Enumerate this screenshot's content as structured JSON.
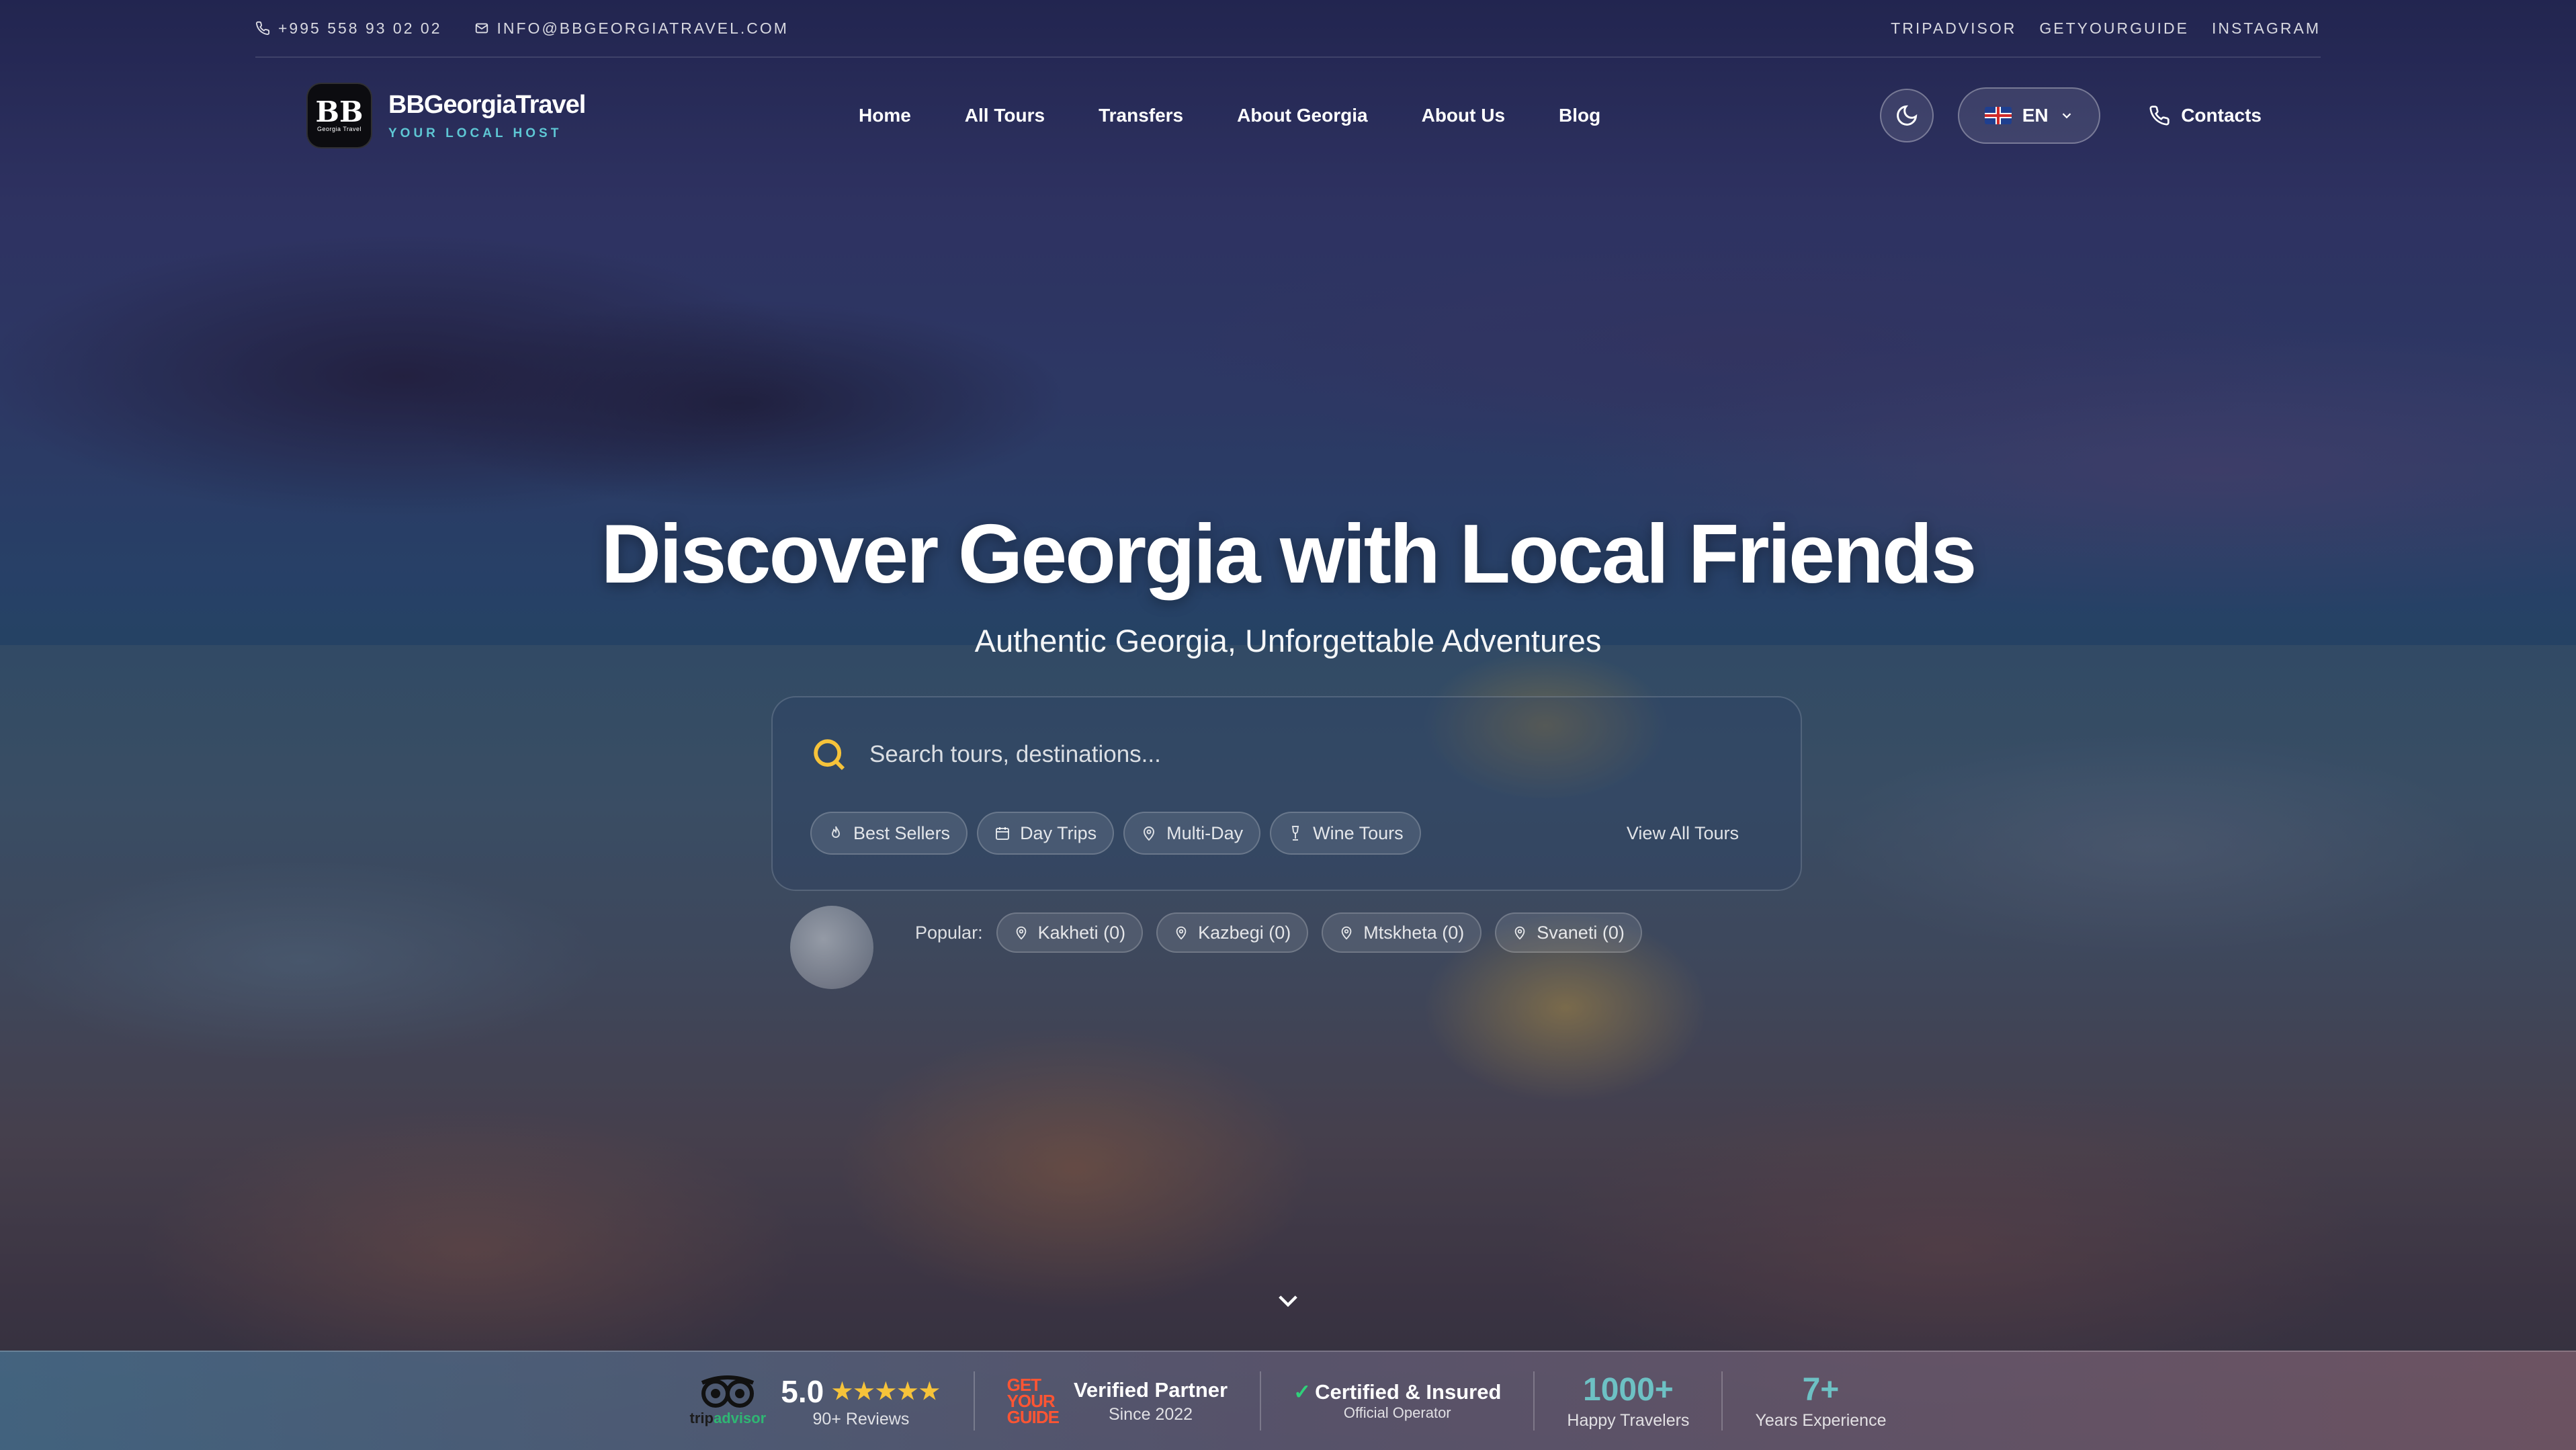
{
  "topbar": {
    "phone": "+995 558 93 02 02",
    "email": "INFO@BBGEORGIATRAVEL.COM",
    "links": [
      "TRIPADVISOR",
      "GETYOURGUIDE",
      "INSTAGRAM"
    ]
  },
  "brand": {
    "logo_text": "BB",
    "logo_subtext": "Georgia Travel",
    "name": "BBGeorgiaTravel",
    "tagline": "YOUR LOCAL HOST"
  },
  "nav": {
    "items": [
      "Home",
      "All Tours",
      "Transfers",
      "About Georgia",
      "About Us",
      "Blog"
    ]
  },
  "header_actions": {
    "theme_icon": "moon-icon",
    "language": "EN",
    "contacts_label": "Contacts"
  },
  "hero": {
    "title": "Discover Georgia with Local Friends",
    "subtitle": "Authentic Georgia, Unforgettable Adventures"
  },
  "search": {
    "placeholder": "Search tours, destinations...",
    "chips": [
      {
        "label": "Best Sellers",
        "icon": "flame-icon"
      },
      {
        "label": "Day Trips",
        "icon": "calendar-icon"
      },
      {
        "label": "Multi-Day",
        "icon": "map-pin-icon"
      },
      {
        "label": "Wine Tours",
        "icon": "wine-glass-icon"
      }
    ],
    "view_all": "View All Tours"
  },
  "popular": {
    "label": "Popular:",
    "items": [
      "Kakheti (0)",
      "Kazbegi (0)",
      "Mtskheta (0)",
      "Svaneti (0)"
    ]
  },
  "trust": {
    "tripadvisor": {
      "word_part1": "trip",
      "word_part2": "advisor",
      "score": "5.0",
      "stars": "★★★★★",
      "reviews": "90+ Reviews"
    },
    "gyg": {
      "logo_lines": [
        "GET",
        "YOUR",
        "GUIDE"
      ],
      "title": "Verified Partner",
      "subtitle": "Since 2022"
    },
    "certified": {
      "check": "✓",
      "title": "Certified & Insured",
      "subtitle": "Official Operator"
    },
    "travelers": {
      "value": "1000+",
      "label": "Happy Travelers"
    },
    "experience": {
      "value": "7+",
      "label": "Years Experience"
    }
  },
  "colors": {
    "accent_teal": "#5ec7d4",
    "search_icon": "#f6c33a",
    "star": "#f6c33a",
    "stat_teal": "#6dc1c4",
    "tripadvisor_green": "#2fb673",
    "gyg_orange": "#ff5533"
  }
}
